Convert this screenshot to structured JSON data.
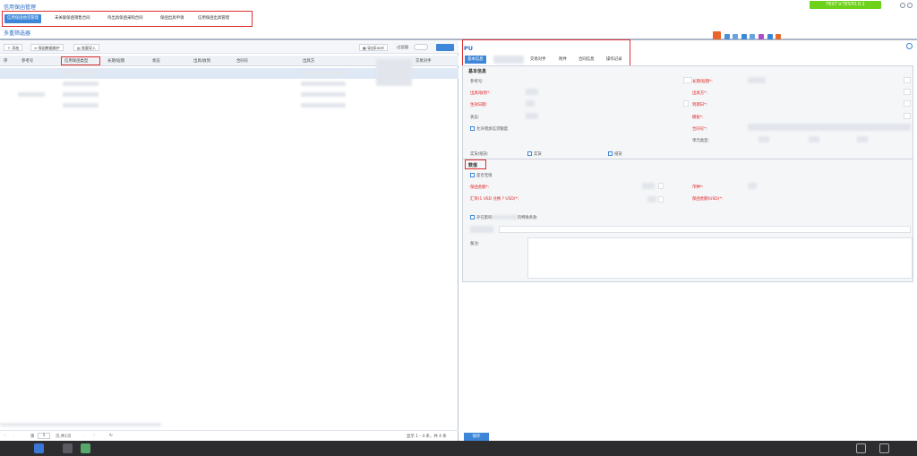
{
  "header": {
    "app_title": "信用保函管理",
    "env_badge": "TEST V.TEST0.0.1",
    "tabs": [
      {
        "label": "信用保函他签管理",
        "active": true
      },
      {
        "label": "未关联保函销售合同",
        "active": false
      },
      {
        "label": "待出具保函采购合同",
        "active": false
      },
      {
        "label": "保函出具申请",
        "active": false
      },
      {
        "label": "信用保函出具管理",
        "active": false
      }
    ],
    "filter_title": "多重筛选器"
  },
  "left": {
    "toolbar": {
      "add": "添加",
      "maintain": "保函数据维护",
      "import": "批量导入",
      "export": "导出Excel",
      "filter": "过滤器"
    },
    "columns": [
      "序",
      "参考号",
      "信用保函类型",
      "长期/短期",
      "状态",
      "出具/收到",
      "合同号",
      "出具方",
      "交易对手"
    ],
    "pager": {
      "page_label": "第",
      "page_value": "1",
      "total_pages": "页,共1页",
      "summary": "显示 1 - 4 条，共 4 条"
    }
  },
  "right": {
    "title": "PU",
    "tabs": [
      {
        "label": "基本信息",
        "active": true
      },
      {
        "label": "交易对手",
        "active": false
      },
      {
        "label": "附件",
        "active": false
      },
      {
        "label": "合同信息",
        "active": false
      },
      {
        "label": "操作记录",
        "active": false
      }
    ],
    "basic": {
      "section": "基本信息",
      "ref_no": "参考号:",
      "issue_receive": "出具/收到*:",
      "effective_date": "生效日期:",
      "status": "状态:",
      "allow_increase": "允许增加信贷额度",
      "long_short": "长期/短期*:",
      "issuer": "出具方*:",
      "expiry_date": "到期日*:",
      "template": "模板*:",
      "contract_no": "合同号*:",
      "unit_type": "单元类型:",
      "goods": "实货/纸货:",
      "opt_goods": "实货",
      "opt_paper": "纸货"
    },
    "numeric": {
      "section": "数值",
      "unlimited": "是否无限",
      "amount": "保函金额*:",
      "rate": "汇率(1 USD 兑换 ? USD)*:",
      "currency": "币种*:",
      "amount_usd": "保函金额(USD)*:",
      "special_terms": "存在影响",
      "special_terms_tail": "的特殊条款",
      "remark": "备注:"
    },
    "save": "保存"
  }
}
